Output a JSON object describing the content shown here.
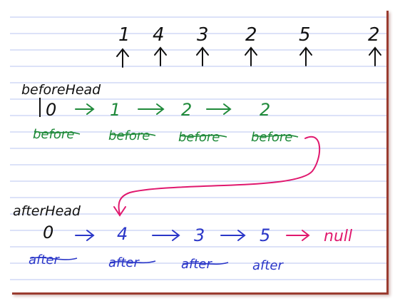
{
  "colors": {
    "black": "#111111",
    "green": "#1f8a3a",
    "blue": "#2a36c8",
    "pink": "#e0186e",
    "rule": "#b9c6f0"
  },
  "input_row": {
    "values": [
      "1",
      "4",
      "3",
      "2",
      "5",
      "2"
    ]
  },
  "before": {
    "head_label": "beforeHead",
    "nodes": [
      "0",
      "1",
      "2",
      "2"
    ],
    "tags": [
      "before",
      "before",
      "before",
      "before"
    ]
  },
  "after": {
    "head_label": "afterHead",
    "nodes": [
      "0",
      "4",
      "3",
      "5"
    ],
    "terminal": "null",
    "tags": [
      "after",
      "after",
      "after",
      "after"
    ]
  }
}
